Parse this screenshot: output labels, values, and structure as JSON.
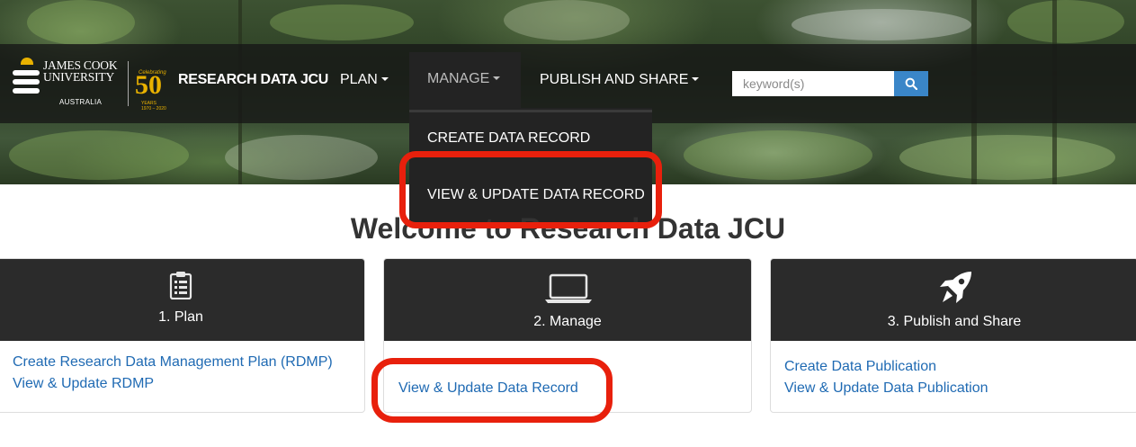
{
  "logo": {
    "name_line1": "JAMES COOK",
    "name_line2": "UNIVERSITY",
    "country": "AUSTRALIA",
    "anniversary_number": "50",
    "anniversary_celebrating": "Celebrating",
    "anniversary_years": "YEARS 1970 – 2020"
  },
  "nav": {
    "brand": "RESEARCH DATA JCU",
    "plan": "PLAN",
    "manage": "MANAGE",
    "publish": "PUBLISH AND SHARE"
  },
  "search": {
    "placeholder": "keyword(s)"
  },
  "dropdown": {
    "items": [
      {
        "label": "CREATE DATA RECORD"
      },
      {
        "label": "VIEW & UPDATE DATA RECORD"
      }
    ]
  },
  "welcome": {
    "title": "Welcome to Research Data JCU"
  },
  "cards": [
    {
      "title": "1. Plan",
      "icon": "clipboard-icon",
      "links": [
        "Create Research Data Management Plan (RDMP)",
        "View & Update RDMP"
      ]
    },
    {
      "title": "2. Manage",
      "icon": "laptop-icon",
      "links": [
        "View & Update Data Record"
      ]
    },
    {
      "title": "3. Publish and Share",
      "icon": "rocket-icon",
      "links": [
        "Create Data Publication",
        "View & Update Data Publication"
      ]
    }
  ],
  "colors": {
    "navbar": "#161616",
    "card_header": "#2b2b2b",
    "link": "#1f6ab3",
    "search_button": "#3a86c8",
    "highlight": "#e8200c",
    "logo_gold": "#e8b100"
  }
}
